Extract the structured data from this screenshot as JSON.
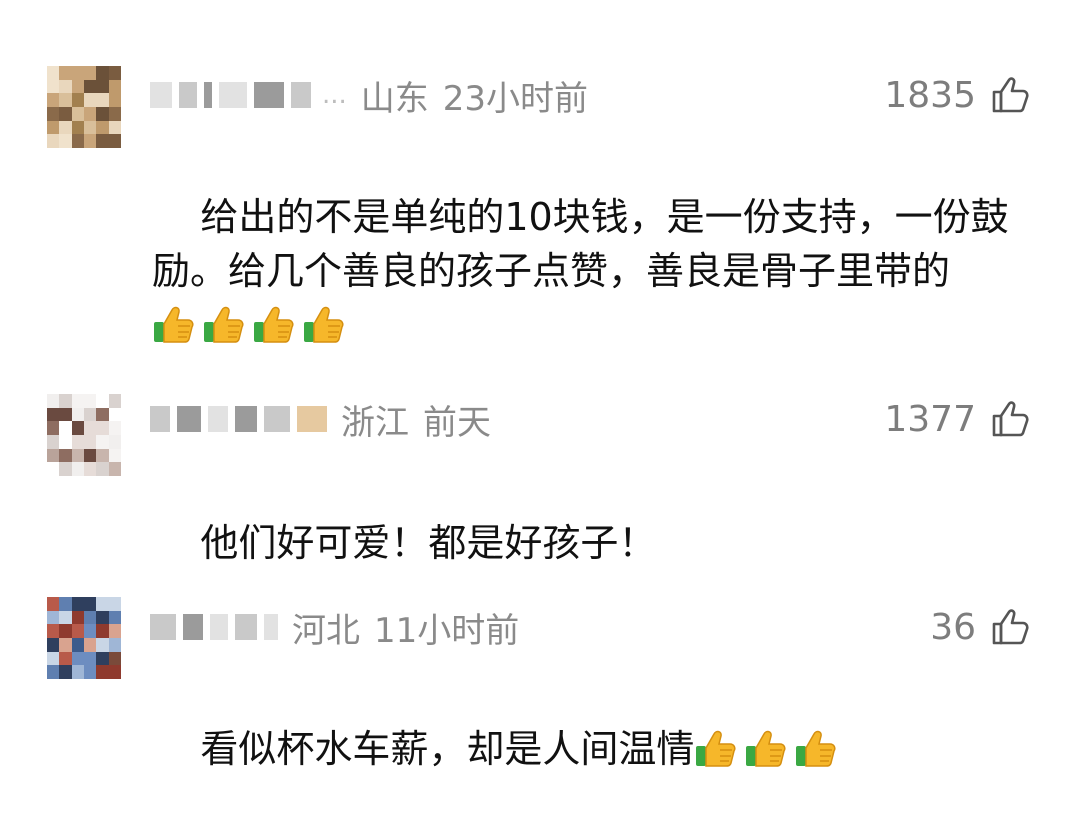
{
  "comments": [
    {
      "location": "山东",
      "time": "23小时前",
      "likes": "1835",
      "text": "给出的不是单纯的10块钱，是一份支持，一份鼓励。给几个善良的孩子点赞，善良是骨子里带的",
      "emoji_count": 4,
      "emoji_name": "thumbs-up-icon"
    },
    {
      "location": "浙江",
      "time": "前天",
      "likes": "1377",
      "text": "他们好可爱！都是好孩子！",
      "emoji_count": 0,
      "emoji_name": ""
    },
    {
      "location": "河北",
      "time": "11小时前",
      "likes": "36",
      "text": "看似杯水车薪，却是人间温情",
      "emoji_count": 3,
      "emoji_name": "thumbs-up-icon"
    }
  ],
  "icons": {
    "like": "thumbs-up-outline-icon",
    "emoji": "thumbs-up-emoji-icon"
  },
  "colors": {
    "meta_text": "#8a8a8a",
    "body_text": "#111111",
    "like_count": "#7d7d7d"
  }
}
